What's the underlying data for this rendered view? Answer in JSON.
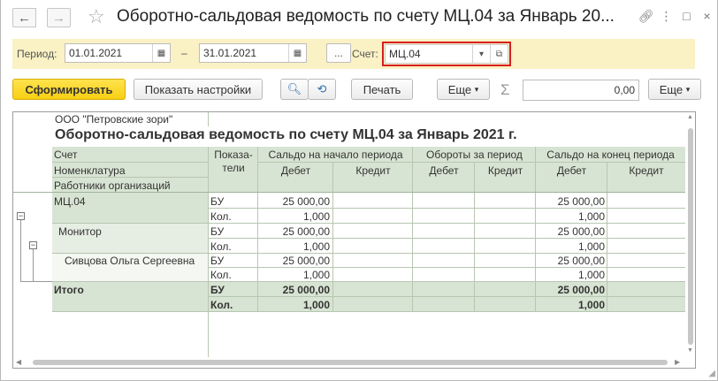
{
  "window": {
    "title": "Оборотно-сальдовая ведомость по счету МЦ.04 за Январь 20...",
    "back_icon": "←",
    "forward_icon": "→",
    "star_icon": "☆",
    "link_icon": "🔗",
    "more_icon": "⋮",
    "maximize_icon": "□",
    "close_icon": "×"
  },
  "period": {
    "label": "Период:",
    "from": "01.01.2021",
    "dash": "–",
    "to": "31.01.2021",
    "dots_label": "...",
    "account_label": "Счет:",
    "account_value": "МЦ.04"
  },
  "toolbar": {
    "generate": "Сформировать",
    "show_settings": "Показать настройки",
    "print": "Печать",
    "more1": "Еще",
    "sum_value": "0,00",
    "more2": "Еще",
    "sigma": "Σ"
  },
  "report": {
    "org": "ООО \"Петровские зори\"",
    "title": "Оборотно-сальдовая ведомость по счету МЦ.04 за Январь 2021 г.",
    "header": {
      "schet": "Счет",
      "nomenklatura": "Номенклатура",
      "rabotniki": "Работники организаций",
      "pokazateli": "Показа-\nтели",
      "saldo_start": "Сальдо на начало периода",
      "oboroty": "Обороты за период",
      "saldo_end": "Сальдо на конец периода",
      "debet": "Дебет",
      "kredit": "Кредит"
    },
    "rows": [
      {
        "name": "МЦ.04",
        "ind": "БУ",
        "sd": "25 000,00",
        "ed": "25 000,00"
      },
      {
        "name": "",
        "ind": "Кол.",
        "sd": "1,000",
        "ed": "1,000"
      },
      {
        "name": "Монитор",
        "ind": "БУ",
        "sd": "25 000,00",
        "ed": "25 000,00"
      },
      {
        "name": "",
        "ind": "Кол.",
        "sd": "1,000",
        "ed": "1,000"
      },
      {
        "name": "Сивцова Ольга Сергеевна",
        "ind": "БУ",
        "sd": "25 000,00",
        "ed": "25 000,00"
      },
      {
        "name": "",
        "ind": "Кол.",
        "sd": "1,000",
        "ed": "1,000"
      }
    ],
    "total": {
      "label": "Итого",
      "row1": {
        "ind": "БУ",
        "sd": "25 000,00",
        "ed": "25 000,00"
      },
      "row2": {
        "ind": "Кол.",
        "sd": "1,000",
        "ed": "1,000"
      }
    }
  }
}
